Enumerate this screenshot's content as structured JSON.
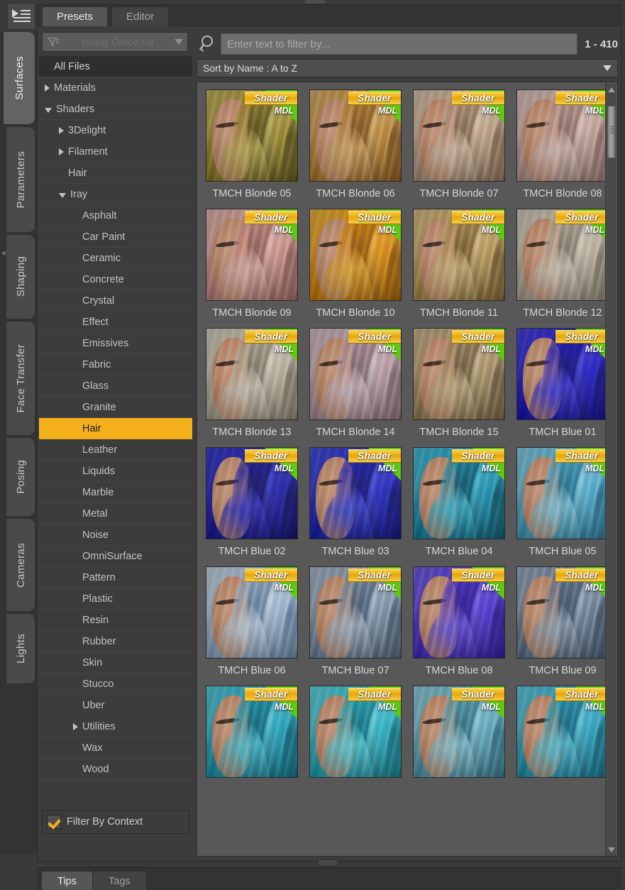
{
  "window": {
    "menu_icon": "menu-list-icon"
  },
  "rail": {
    "tabs": [
      {
        "label": "Surfaces",
        "active": true
      },
      {
        "label": "Parameters",
        "active": false
      },
      {
        "label": "Shaping",
        "active": false
      },
      {
        "label": "Face Transfer",
        "active": false
      },
      {
        "label": "Posing",
        "active": false
      },
      {
        "label": "Cameras",
        "active": false
      },
      {
        "label": "Lights",
        "active": false
      }
    ]
  },
  "tabs": [
    {
      "label": "Presets",
      "active": true
    },
    {
      "label": "Editor",
      "active": false
    }
  ],
  "filter_combo": {
    "value": "Young Grace Ha",
    "icon": "funnel-icon",
    "caret": "chevron-down-icon"
  },
  "tree": [
    {
      "label": "All Files",
      "indent": 0,
      "arrow": "none",
      "state": "selected-dark"
    },
    {
      "label": "Materials",
      "indent": 0,
      "arrow": "collapsed",
      "state": "normal"
    },
    {
      "label": "Shaders",
      "indent": 0,
      "arrow": "expanded",
      "state": "normal"
    },
    {
      "label": "3Delight",
      "indent": 1,
      "arrow": "collapsed",
      "state": "normal"
    },
    {
      "label": "Filament",
      "indent": 1,
      "arrow": "collapsed",
      "state": "normal"
    },
    {
      "label": "Hair",
      "indent": 1,
      "arrow": "none",
      "state": "normal"
    },
    {
      "label": "Iray",
      "indent": 1,
      "arrow": "expanded",
      "state": "normal"
    },
    {
      "label": "Asphalt",
      "indent": 2,
      "arrow": "none",
      "state": "normal"
    },
    {
      "label": "Car Paint",
      "indent": 2,
      "arrow": "none",
      "state": "normal"
    },
    {
      "label": "Ceramic",
      "indent": 2,
      "arrow": "none",
      "state": "normal"
    },
    {
      "label": "Concrete",
      "indent": 2,
      "arrow": "none",
      "state": "normal"
    },
    {
      "label": "Crystal",
      "indent": 2,
      "arrow": "none",
      "state": "normal"
    },
    {
      "label": "Effect",
      "indent": 2,
      "arrow": "none",
      "state": "normal"
    },
    {
      "label": "Emissives",
      "indent": 2,
      "arrow": "none",
      "state": "normal"
    },
    {
      "label": "Fabric",
      "indent": 2,
      "arrow": "none",
      "state": "normal"
    },
    {
      "label": "Glass",
      "indent": 2,
      "arrow": "none",
      "state": "normal"
    },
    {
      "label": "Granite",
      "indent": 2,
      "arrow": "none",
      "state": "normal"
    },
    {
      "label": "Hair",
      "indent": 2,
      "arrow": "none",
      "state": "selected-gold"
    },
    {
      "label": "Leather",
      "indent": 2,
      "arrow": "none",
      "state": "normal"
    },
    {
      "label": "Liquids",
      "indent": 2,
      "arrow": "none",
      "state": "normal"
    },
    {
      "label": "Marble",
      "indent": 2,
      "arrow": "none",
      "state": "normal"
    },
    {
      "label": "Metal",
      "indent": 2,
      "arrow": "none",
      "state": "normal"
    },
    {
      "label": "Noise",
      "indent": 2,
      "arrow": "none",
      "state": "normal"
    },
    {
      "label": "OmniSurface",
      "indent": 2,
      "arrow": "none",
      "state": "normal"
    },
    {
      "label": "Pattern",
      "indent": 2,
      "arrow": "none",
      "state": "normal"
    },
    {
      "label": "Plastic",
      "indent": 2,
      "arrow": "none",
      "state": "normal"
    },
    {
      "label": "Resin",
      "indent": 2,
      "arrow": "none",
      "state": "normal"
    },
    {
      "label": "Rubber",
      "indent": 2,
      "arrow": "none",
      "state": "normal"
    },
    {
      "label": "Skin",
      "indent": 2,
      "arrow": "none",
      "state": "normal"
    },
    {
      "label": "Stucco",
      "indent": 2,
      "arrow": "none",
      "state": "normal"
    },
    {
      "label": "Uber",
      "indent": 2,
      "arrow": "none",
      "state": "normal"
    },
    {
      "label": "Utilities",
      "indent": 2,
      "arrow": "collapsed",
      "state": "normal"
    },
    {
      "label": "Wax",
      "indent": 2,
      "arrow": "none",
      "state": "normal"
    },
    {
      "label": "Wood",
      "indent": 2,
      "arrow": "none",
      "state": "normal"
    }
  ],
  "context_filter": {
    "label": "Filter By Context",
    "checked": true,
    "check_color": "#f2b01c"
  },
  "search": {
    "placeholder": "Enter text to filter by...",
    "value": "",
    "icon": "search-icon",
    "count": "1 - 410"
  },
  "sort": {
    "label": "Sort by Name : A to Z",
    "caret": "chevron-down-icon"
  },
  "grid": {
    "badge_shader": "Shader",
    "badge_mdl": "MDL",
    "items": [
      {
        "label": "TMCH Blonde 05",
        "hair_dark": "#4e4413",
        "hair_mid": "#9d8a27",
        "hair_light": "#cdbc63"
      },
      {
        "label": "TMCH Blonde 06",
        "hair_dark": "#7a4a16",
        "hair_mid": "#c08a33",
        "hair_light": "#e3b973"
      },
      {
        "label": "TMCH Blonde 07",
        "hair_dark": "#7e6348",
        "hair_mid": "#c0a286",
        "hair_light": "#e3cdb6"
      },
      {
        "label": "TMCH Blonde 08",
        "hair_dark": "#8a6a62",
        "hair_mid": "#c6a49c",
        "hair_light": "#e6cdc7"
      },
      {
        "label": "TMCH Blonde 09",
        "hair_dark": "#8d5b55",
        "hair_mid": "#cf9088",
        "hair_light": "#ebc0ba"
      },
      {
        "label": "TMCH Blonde 10",
        "hair_dark": "#8a4f04",
        "hair_mid": "#e08c08",
        "hair_light": "#f6bc3e"
      },
      {
        "label": "TMCH Blonde 11",
        "hair_dark": "#6d5322",
        "hair_mid": "#b99a57",
        "hair_light": "#e0c78e"
      },
      {
        "label": "TMCH Blonde 12",
        "hair_dark": "#7d7566",
        "hair_mid": "#bdb3a0",
        "hair_light": "#ded7c8"
      },
      {
        "label": "TMCH Blonde 13",
        "hair_dark": "#7a7463",
        "hair_mid": "#bab39d",
        "hair_light": "#ddd8c9"
      },
      {
        "label": "TMCH Blonde 14",
        "hair_dark": "#7d6470",
        "hair_mid": "#bb9ba6",
        "hair_light": "#ddc8d0"
      },
      {
        "label": "TMCH Blonde 15",
        "hair_dark": "#6a563a",
        "hair_mid": "#a88f63",
        "hair_light": "#d3c095"
      },
      {
        "label": "TMCH Blue 01",
        "hair_dark": "#0a0a6e",
        "hair_mid": "#1712c6",
        "hair_light": "#4a44ea"
      },
      {
        "label": "TMCH Blue 02",
        "hair_dark": "#0a0a55",
        "hair_mid": "#1a1aa8",
        "hair_light": "#3c3cd8"
      },
      {
        "label": "TMCH Blue 03",
        "hair_dark": "#0c0c66",
        "hair_mid": "#1b1fc2",
        "hair_light": "#4753e8"
      },
      {
        "label": "TMCH Blue 04",
        "hair_dark": "#07485c",
        "hair_mid": "#1391b4",
        "hair_light": "#49c8e2"
      },
      {
        "label": "TMCH Blue 05",
        "hair_dark": "#1b6a88",
        "hair_mid": "#49aace",
        "hair_light": "#90d8ee"
      },
      {
        "label": "TMCH Blue 06",
        "hair_dark": "#5b7a99",
        "hair_mid": "#9bb6d2",
        "hair_light": "#cfe0ee"
      },
      {
        "label": "TMCH Blue 07",
        "hair_dark": "#43566c",
        "hair_mid": "#7d93ab",
        "hair_light": "#b4c5d6"
      },
      {
        "label": "TMCH Blue 08",
        "hair_dark": "#20118a",
        "hair_mid": "#4a2fd2",
        "hair_light": "#7a63ef"
      },
      {
        "label": "TMCH Blue 09",
        "hair_dark": "#3a4c62",
        "hair_mid": "#6b8099",
        "hair_light": "#a3b6c8"
      },
      {
        "label": "",
        "hair_dark": "#0a5d72",
        "hair_mid": "#18a2bd",
        "hair_light": "#5fd3e6"
      },
      {
        "label": "",
        "hair_dark": "#0d6b7a",
        "hair_mid": "#1fb2c4",
        "hair_light": "#6ce0ee"
      },
      {
        "label": "",
        "hair_dark": "#2a6a7e",
        "hair_mid": "#5aa9bd",
        "hair_light": "#9cd8e6"
      },
      {
        "label": "",
        "hair_dark": "#0f5f78",
        "hair_mid": "#22a2bf",
        "hair_light": "#6ad4ea"
      }
    ]
  },
  "bottom_tabs": [
    {
      "label": "Tips",
      "active": true
    },
    {
      "label": "Tags",
      "active": false
    }
  ],
  "colors": {
    "accent_gold": "#f5b01e",
    "badge_green": "#5fc80f",
    "panel_bg": "#3c3c3c",
    "grid_bg": "#585858"
  }
}
